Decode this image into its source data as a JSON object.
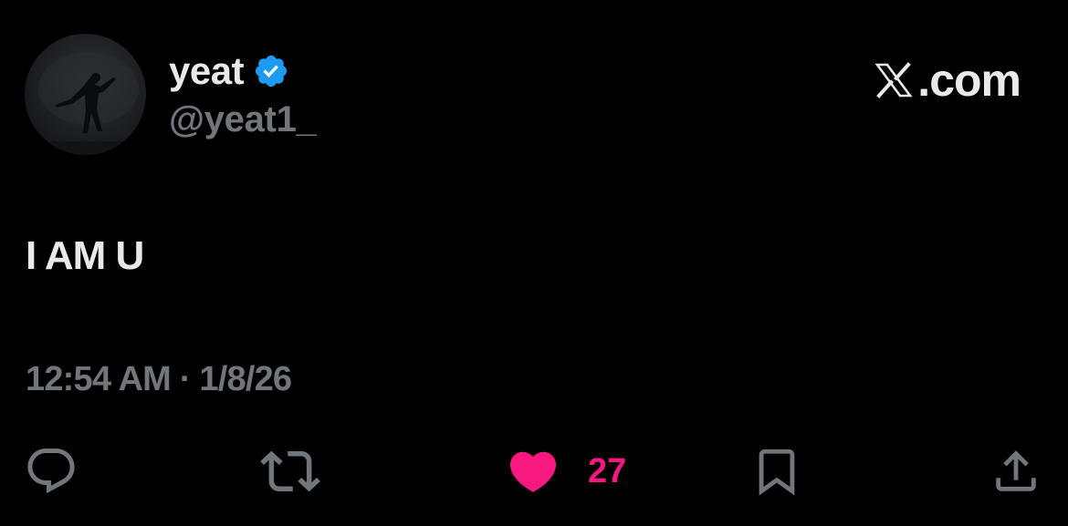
{
  "author": {
    "display_name": "yeat",
    "handle": "@yeat1_",
    "verified": true,
    "avatar_icon": "profile-photo-performer"
  },
  "brand": {
    "logo_icon": "x-logo-icon",
    "text": ".com"
  },
  "tweet": {
    "text": "I AM U",
    "timestamp": "12:54 AM · 1/8/26"
  },
  "actions": {
    "reply_icon": "reply-icon",
    "retweet_icon": "retweet-icon",
    "like_icon": "heart-icon",
    "like_count": "27",
    "bookmark_icon": "bookmark-icon",
    "share_icon": "share-icon"
  },
  "colors": {
    "background": "#000000",
    "primary_text": "#e7e9ea",
    "secondary_text": "#71767b",
    "verified_blue": "#1d9bf0",
    "like_pink": "#f91880"
  }
}
